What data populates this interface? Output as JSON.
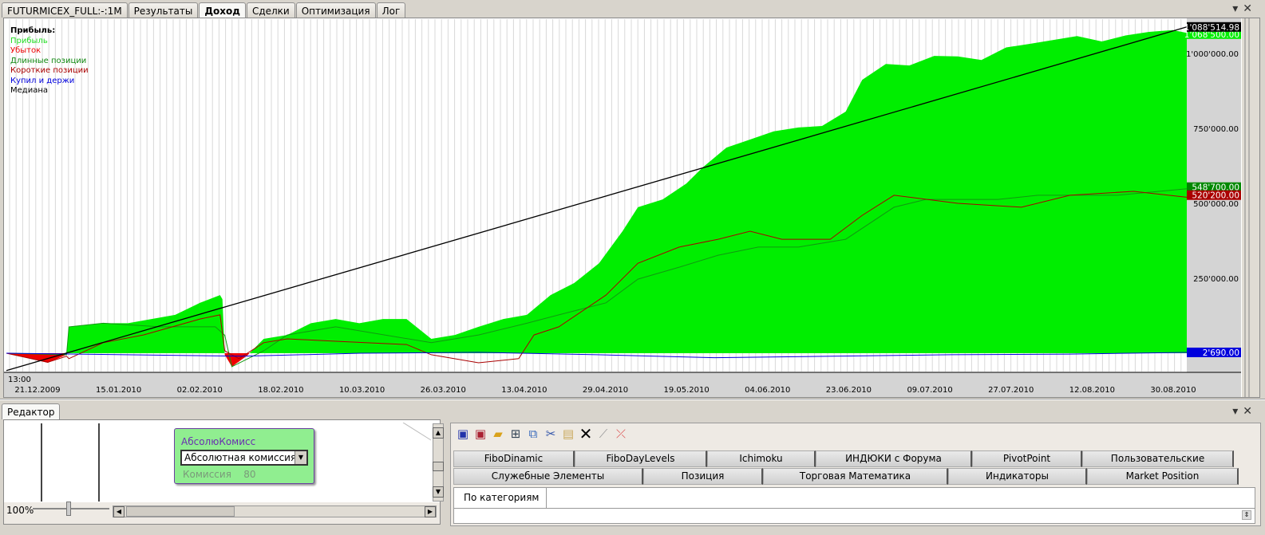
{
  "tabs": [
    "FUTURMICEX_FULL:-:1M",
    "Результаты",
    "Доход",
    "Сделки",
    "Оптимизация",
    "Лог"
  ],
  "active_tab": "Доход",
  "legend": {
    "title": "Прибыль:",
    "items": [
      {
        "label": "Прибыль",
        "color": "#00ee00"
      },
      {
        "label": "Убыток",
        "color": "#ee0000"
      },
      {
        "label": "Длинные позиции",
        "color": "#008800"
      },
      {
        "label": "Короткие позиции",
        "color": "#aa0000"
      },
      {
        "label": "Купил и держи",
        "color": "#0000dd"
      },
      {
        "label": "Медиана",
        "color": "#000000"
      }
    ]
  },
  "chart_data": {
    "type": "area",
    "title": "Доход",
    "xlabel": "",
    "ylabel": "",
    "x_unit": "bar index",
    "xlim": [
      0,
      100
    ],
    "ylim": [
      -85000,
      1100000
    ],
    "time_label": "13:00",
    "x_ticks": [
      "21.12.2009",
      "15.01.2010",
      "02.02.2010",
      "18.02.2010",
      "10.03.2010",
      "26.03.2010",
      "13.04.2010",
      "29.04.2010",
      "19.05.2010",
      "04.06.2010",
      "23.06.2010",
      "09.07.2010",
      "27.07.2010",
      "12.08.2010",
      "30.08.2010"
    ],
    "y_ticks": [
      {
        "value": 250000,
        "label": "250'000.00"
      },
      {
        "value": 500000,
        "label": "500'000.00"
      },
      {
        "value": 750000,
        "label": "750'000.00"
      },
      {
        "value": 1000000,
        "label": "1'000'000.00"
      }
    ],
    "last_value_labels": [
      {
        "series": "Медиана",
        "value": 1088514.98,
        "label": "1'088'514.98",
        "bg": "#000000"
      },
      {
        "series": "Прибыль",
        "value": 1068500,
        "label": "1'068'500.00",
        "bg": "#00ee00"
      },
      {
        "series": "Длинные позиции",
        "value": 548700,
        "label": "548'700.00",
        "bg": "#008800"
      },
      {
        "series": "Короткие позиции",
        "value": 520200,
        "label": "520'200.00",
        "bg": "#aa0000"
      },
      {
        "series": "Купил и держи",
        "value": 2690,
        "label": "2'690.00",
        "bg": "#0000dd"
      }
    ],
    "series": [
      {
        "name": "Прибыль/Убыток",
        "kind": "area",
        "pos_color": "#00ee00",
        "neg_color": "#ee0000",
        "points": [
          [
            0,
            0
          ],
          [
            1.5,
            -13000
          ],
          [
            3.5,
            -32000
          ],
          [
            5.1,
            -5000
          ],
          [
            5.3,
            88000
          ],
          [
            8.2,
            100000
          ],
          [
            10.3,
            100000
          ],
          [
            12.3,
            114000
          ],
          [
            14.3,
            128000
          ],
          [
            16.4,
            168000
          ],
          [
            18.1,
            194000
          ],
          [
            18.3,
            180000
          ],
          [
            18.5,
            -5000
          ],
          [
            19.1,
            -45000
          ],
          [
            20.4,
            -8000
          ],
          [
            21.8,
            48000
          ],
          [
            23.8,
            61000
          ],
          [
            25.8,
            100000
          ],
          [
            27.9,
            114000
          ],
          [
            29.9,
            100000
          ],
          [
            31.9,
            114000
          ],
          [
            33.9,
            114000
          ],
          [
            36.0,
            48000
          ],
          [
            38.0,
            61000
          ],
          [
            40.0,
            88000
          ],
          [
            42.1,
            114000
          ],
          [
            44.1,
            128000
          ],
          [
            46.1,
            194000
          ],
          [
            48.1,
            234000
          ],
          [
            50.2,
            300000
          ],
          [
            52.2,
            407000
          ],
          [
            53.5,
            487000
          ],
          [
            55.6,
            513000
          ],
          [
            57.6,
            566000
          ],
          [
            59.0,
            620000
          ],
          [
            61.0,
            686000
          ],
          [
            63.0,
            713000
          ],
          [
            65.0,
            740000
          ],
          [
            67.1,
            753000
          ],
          [
            69.1,
            758000
          ],
          [
            71.1,
            806000
          ],
          [
            72.5,
            912000
          ],
          [
            74.5,
            965000
          ],
          [
            76.5,
            960000
          ],
          [
            78.6,
            992000
          ],
          [
            80.6,
            990000
          ],
          [
            82.6,
            978000
          ],
          [
            84.7,
            1020000
          ],
          [
            86.7,
            1032000
          ],
          [
            88.7,
            1045000
          ],
          [
            90.7,
            1058000
          ],
          [
            92.8,
            1040000
          ],
          [
            94.8,
            1060000
          ],
          [
            96.8,
            1072000
          ],
          [
            98.8,
            1078000
          ],
          [
            100,
            1068500
          ]
        ]
      },
      {
        "name": "Длинные позиции",
        "kind": "line",
        "color": "#119911",
        "points": [
          [
            0,
            0
          ],
          [
            5.1,
            -5000
          ],
          [
            5.3,
            88000
          ],
          [
            8.2,
            100000
          ],
          [
            13.0,
            88000
          ],
          [
            17.7,
            88000
          ],
          [
            18.5,
            60000
          ],
          [
            19.1,
            -45000
          ],
          [
            21.8,
            8000
          ],
          [
            23.8,
            61000
          ],
          [
            27.9,
            88000
          ],
          [
            36.0,
            35000
          ],
          [
            40.0,
            61000
          ],
          [
            44.1,
            100000
          ],
          [
            46.8,
            128000
          ],
          [
            50.8,
            168000
          ],
          [
            53.5,
            247000
          ],
          [
            57.0,
            287000
          ],
          [
            60.3,
            327000
          ],
          [
            63.7,
            354000
          ],
          [
            67.1,
            354000
          ],
          [
            71.1,
            380000
          ],
          [
            75.2,
            487000
          ],
          [
            77.9,
            513000
          ],
          [
            84.0,
            513000
          ],
          [
            87.4,
            527000
          ],
          [
            94.1,
            527000
          ],
          [
            100,
            548700
          ]
        ]
      },
      {
        "name": "Короткие позиции",
        "kind": "line",
        "color": "#aa0000",
        "points": [
          [
            0,
            0
          ],
          [
            3.5,
            -30000
          ],
          [
            5.1,
            -10000
          ],
          [
            5.3,
            -18000
          ],
          [
            8.2,
            35000
          ],
          [
            11.6,
            61000
          ],
          [
            16.4,
            114000
          ],
          [
            18.1,
            128000
          ],
          [
            18.5,
            8000
          ],
          [
            19.7,
            -18000
          ],
          [
            21.8,
            35000
          ],
          [
            23.8,
            48000
          ],
          [
            27.9,
            40000
          ],
          [
            33.9,
            29000
          ],
          [
            36.0,
            -5000
          ],
          [
            40.0,
            -32000
          ],
          [
            43.4,
            -18000
          ],
          [
            44.7,
            61000
          ],
          [
            46.8,
            88000
          ],
          [
            50.8,
            194000
          ],
          [
            53.5,
            300000
          ],
          [
            57.0,
            354000
          ],
          [
            60.3,
            380000
          ],
          [
            63.0,
            407000
          ],
          [
            65.7,
            380000
          ],
          [
            69.8,
            380000
          ],
          [
            72.5,
            460000
          ],
          [
            75.2,
            527000
          ],
          [
            80.6,
            500000
          ],
          [
            86.0,
            487000
          ],
          [
            90.1,
            527000
          ],
          [
            95.5,
            540000
          ],
          [
            100,
            520200
          ]
        ]
      },
      {
        "name": "Купил и держи",
        "kind": "line",
        "color": "#0000dd",
        "points": [
          [
            0,
            0
          ],
          [
            10,
            -5000
          ],
          [
            20,
            -10000
          ],
          [
            30,
            0
          ],
          [
            40,
            3000
          ],
          [
            50,
            -5000
          ],
          [
            60,
            -15000
          ],
          [
            70,
            -10000
          ],
          [
            80,
            -5000
          ],
          [
            90,
            -3000
          ],
          [
            100,
            2690
          ]
        ]
      },
      {
        "name": "Медиана",
        "kind": "line",
        "color": "#000000",
        "points": [
          [
            0,
            -58000
          ],
          [
            100,
            1088514.98
          ]
        ]
      }
    ]
  },
  "editor": {
    "tab": "Редактор",
    "zoom": "100%",
    "node": {
      "title": "АбсолюКомисс",
      "select_value": "Абсолютная комиссия",
      "param_label": "Комиссия",
      "param_value": "80"
    }
  },
  "toolbox": {
    "row1": [
      "FiboDinamic",
      "FiboDayLevels",
      "Ichimoku",
      "ИНДЮКИ с Форума",
      "PivotPoint",
      "Пользовательские"
    ],
    "row2": [
      "Служебные Элементы",
      "Позиция",
      "Торговая Математика",
      "Индикаторы",
      "Market Position"
    ],
    "category_tab": "По категориям"
  }
}
